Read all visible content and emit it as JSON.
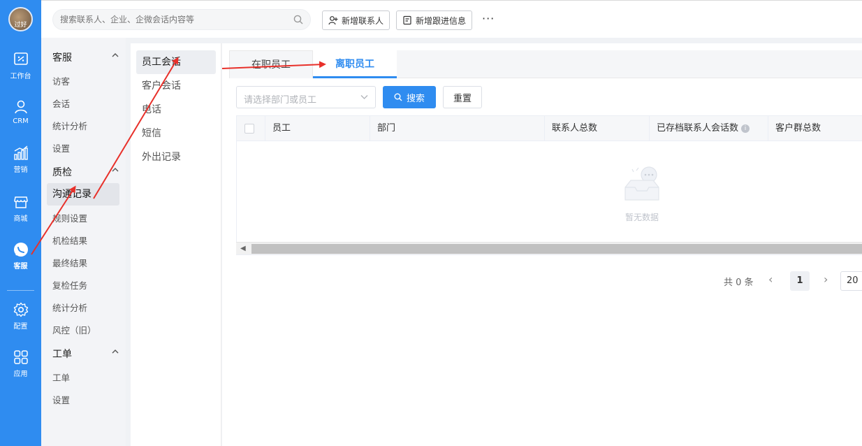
{
  "user": {
    "avatar_text": "过好"
  },
  "rail": [
    {
      "label": "工作台",
      "icon": "workbench-icon"
    },
    {
      "label": "CRM",
      "icon": "user-icon"
    },
    {
      "label": "营销",
      "icon": "chart-icon"
    },
    {
      "label": "商城",
      "icon": "store-icon"
    },
    {
      "label": "客服",
      "icon": "chat-bubble-icon",
      "active": true
    },
    {
      "label": "配置",
      "icon": "gear-icon"
    },
    {
      "label": "应用",
      "icon": "apps-icon"
    }
  ],
  "topbar": {
    "search_placeholder": "搜索联系人、企业、企微会话内容等",
    "add_contact": "新增联系人",
    "add_followup": "新增跟进信息",
    "more": "···"
  },
  "nav2": {
    "group1": "客服",
    "g1_items": [
      "访客",
      "会话",
      "统计分析",
      "设置"
    ],
    "group2": "质检",
    "g2_items": [
      "沟通记录",
      "规则设置",
      "机检结果",
      "最终结果",
      "复检任务",
      "统计分析",
      "风控（旧）"
    ],
    "group3": "工单",
    "g3_items": [
      "工单",
      "设置"
    ]
  },
  "nav3": [
    "员工会话",
    "客户会话",
    "电话",
    "短信",
    "外出记录"
  ],
  "tabs": [
    "在职员工",
    "离职员工"
  ],
  "filter": {
    "placeholder": "请选择部门或员工",
    "search": "搜索",
    "reset": "重置"
  },
  "table": {
    "columns": [
      "员工",
      "部门",
      "联系人总数",
      "已存档联系人会话数",
      "客户群总数"
    ],
    "empty_text": "暂无数据"
  },
  "pager": {
    "total": "共 0 条",
    "current": "1",
    "size": "20"
  },
  "colors": {
    "primary": "#2f8cf0",
    "annotation": "#e8302a"
  }
}
